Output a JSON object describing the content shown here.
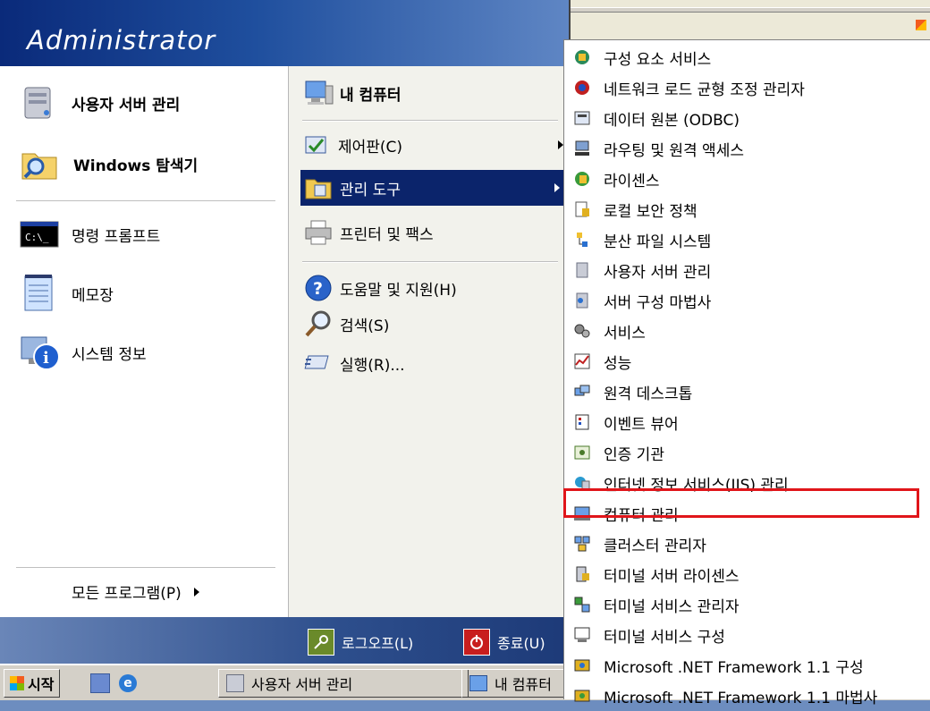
{
  "user": {
    "name": "Administrator"
  },
  "pinned": [
    {
      "label": "사용자 서버 관리",
      "icon": "server-manage-icon"
    },
    {
      "label": "Windows 탐색기",
      "icon": "folder-search-icon"
    }
  ],
  "recent": [
    {
      "label": "명령 프롬프트",
      "icon": "command-prompt-icon"
    },
    {
      "label": "메모장",
      "icon": "notepad-icon"
    },
    {
      "label": "시스템 정보",
      "icon": "system-info-icon"
    }
  ],
  "all_programs": "모든 프로그램(P)",
  "right": {
    "my_computer": "내 컴퓨터",
    "control_panel": "제어판(C)",
    "admin_tools": "관리 도구",
    "printers": "프린터 및 팩스",
    "help": "도움말 및 지원(H)",
    "search": "검색(S)",
    "run": "실행(R)..."
  },
  "footer": {
    "logoff": "로그오프(L)",
    "shutdown": "종료(U)"
  },
  "taskbar": {
    "start": "시작",
    "tasks": [
      "사용자 서버 관리",
      "내 컴퓨터"
    ]
  },
  "admin_tools_menu": [
    "구성 요소 서비스",
    "네트워크 로드 균형 조정 관리자",
    "데이터 원본 (ODBC)",
    "라우팅 및 원격 액세스",
    "라이센스",
    "로컬 보안 정책",
    "분산 파일 시스템",
    "사용자 서버 관리",
    "서버 구성 마법사",
    "서비스",
    "성능",
    "원격 데스크톱",
    "이벤트 뷰어",
    "인증 기관",
    "인터넷 정보 서비스(IIS) 관리",
    "컴퓨터 관리",
    "클러스터 관리자",
    "터미널 서버 라이센스",
    "터미널 서비스 관리자",
    "터미널 서비스 구성",
    "Microsoft .NET Framework 1.1 구성",
    "Microsoft .NET Framework 1.1 마법사"
  ],
  "highlighted_item": "컴퓨터 관리",
  "colors": {
    "selection": "#0b246b",
    "highlight_box": "#e0151a",
    "header": "#1f4f9e"
  }
}
